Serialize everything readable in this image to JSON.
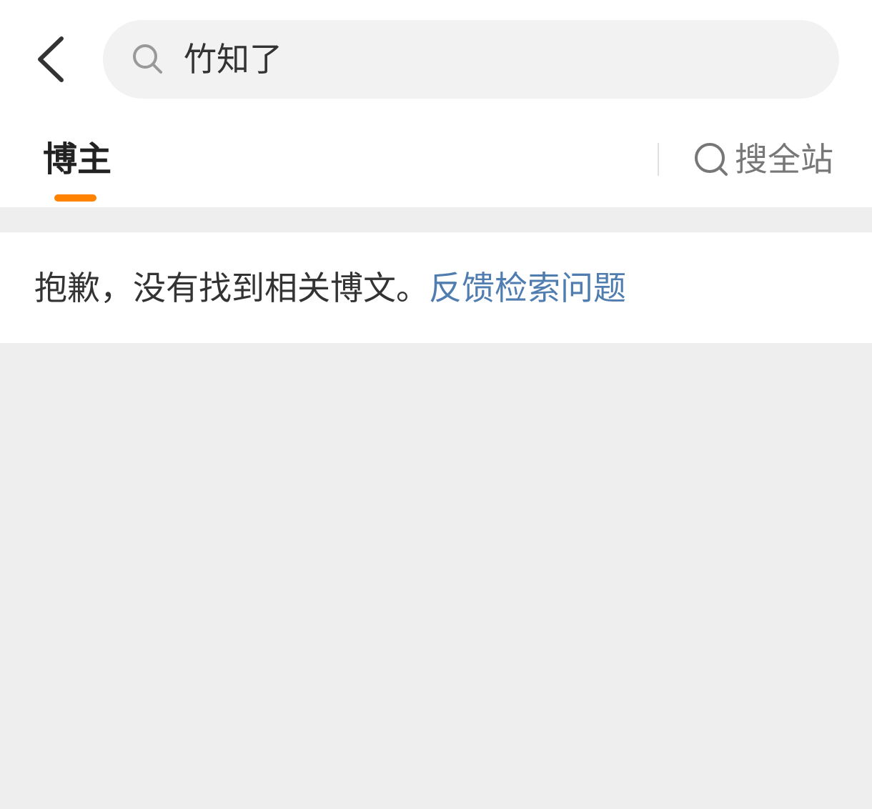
{
  "header": {
    "back_icon": "chevron-left-icon",
    "search": {
      "icon": "search-icon",
      "query": "竹知了"
    }
  },
  "tabs": {
    "active": {
      "label": "博主"
    },
    "indicator_color": "#FF8200",
    "site_search": {
      "icon": "search-icon",
      "label": "搜全站"
    }
  },
  "results": {
    "empty_message": "抱歉，没有找到相关博文。",
    "feedback_link": "反馈检索问题",
    "link_color": "#507DAF"
  }
}
